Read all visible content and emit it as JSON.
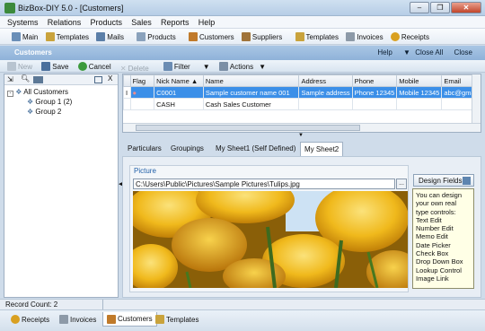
{
  "window": {
    "title": "BizBox-DIY 5.0 - [Customers]",
    "minimize": "–",
    "restore": "❐",
    "close": "✕"
  },
  "menu": [
    "Systems",
    "Relations",
    "Products",
    "Sales",
    "Reports",
    "Help"
  ],
  "toolbar": [
    {
      "label": "Main",
      "icon": "home-icon",
      "color": "#6a8fb8"
    },
    {
      "label": "Templates",
      "icon": "templates-icon",
      "color": "#c9a33c"
    },
    {
      "label": "Mails",
      "icon": "mail-icon",
      "color": "#5b7fa8"
    },
    {
      "label": "Products",
      "icon": "products-icon",
      "color": "#8aa2bc"
    },
    {
      "label": "Customers",
      "icon": "customers-icon",
      "color": "#c07a2a"
    },
    {
      "label": "Suppliers",
      "icon": "suppliers-icon",
      "color": "#a0743a"
    },
    {
      "label": "Templates",
      "icon": "templates-icon",
      "color": "#c9a33c"
    },
    {
      "label": "Invoices",
      "icon": "invoices-icon",
      "color": "#8d9aa8"
    },
    {
      "label": "Receipts",
      "icon": "receipts-icon",
      "color": "#d9a020"
    }
  ],
  "header": {
    "label": "Customers",
    "help": "Help",
    "close_all": "Close All",
    "close": "Close"
  },
  "commands": {
    "new": "New",
    "save": "Save",
    "cancel": "Cancel",
    "delete": "Delete",
    "filter": "Filter",
    "actions": "Actions"
  },
  "tree": {
    "root": "All Customers",
    "groups": [
      "Group 1 (2)",
      "Group 2"
    ]
  },
  "grid": {
    "columns": [
      "Flag",
      "Nick Name ▲",
      "Name",
      "Address",
      "Phone",
      "Mobile",
      "Email"
    ],
    "rows": [
      {
        "marker": "I",
        "flag": "●",
        "nick": "C0001",
        "name": "Sample customer name 001",
        "address": "Sample address",
        "phone": "Phone 12345",
        "mobile": "Mobile 12345",
        "email": "abc@gmail",
        "selected": true
      },
      {
        "marker": "",
        "flag": "",
        "nick": "CASH",
        "name": "Cash Sales Customer",
        "address": "",
        "phone": "",
        "mobile": "",
        "email": "",
        "selected": false
      }
    ]
  },
  "detail_tabs": [
    "Particulars",
    "Groupings",
    "My Sheet1 (Self Defined)",
    "My Sheet2"
  ],
  "picture": {
    "label": "Picture",
    "path": "C:\\Users\\Public\\Pictures\\Sample Pictures\\Tulips.jpg",
    "browse": "..."
  },
  "design": {
    "button": "Design Fields",
    "note": [
      "You can design",
      "your own real",
      "type controls:",
      "Text Edit",
      "Number Edit",
      "Memo Edit",
      "Date Picker",
      "Check Box",
      "Drop Down Box",
      "Lookup Control",
      "Image Link"
    ]
  },
  "status": {
    "record_count": "Record Count: 2"
  },
  "bottom_tabs": [
    {
      "label": "Receipts",
      "icon": "receipts-icon",
      "active": false
    },
    {
      "label": "Invoices",
      "icon": "invoices-icon",
      "active": false
    },
    {
      "label": "Customers",
      "icon": "customers-icon",
      "active": true
    },
    {
      "label": "Templates",
      "icon": "templates-icon",
      "active": false
    }
  ],
  "colors": {
    "accent": "#3b8fe8",
    "header_band": "#8fb2d9",
    "tulip_yellow": "#f2c31f"
  }
}
